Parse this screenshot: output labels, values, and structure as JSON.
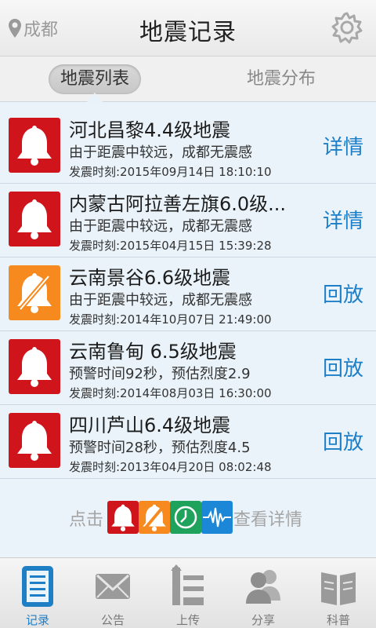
{
  "header": {
    "location": "成都",
    "title": "地震记录"
  },
  "tabs": [
    {
      "label": "地震列表",
      "active": true
    },
    {
      "label": "地震分布",
      "active": false
    }
  ],
  "records": [
    {
      "title": "河北昌黎4.4级地震",
      "subtitle": "由于距震中较远，成都无震感",
      "time": "发震时刻:2015年09月14日 18:10:10",
      "action": "详情",
      "icon": "bell-icon",
      "icon_color": "#d0141c"
    },
    {
      "title": "内蒙古阿拉善左旗6.0级...",
      "subtitle": "由于距震中较远，成都无震感",
      "time": "发震时刻:2015年04月15日 15:39:28",
      "action": "详情",
      "icon": "bell-icon",
      "icon_color": "#d0141c"
    },
    {
      "title": "云南景谷6.6级地震",
      "subtitle": "由于距震中较远，成都无震感",
      "time": "发震时刻:2014年10月07日 21:49:00",
      "action": "回放",
      "icon": "bell-muted-icon",
      "icon_color": "#f68a1f"
    },
    {
      "title": "云南鲁甸 6.5级地震",
      "subtitle": "预警时间92秒，预估烈度2.9",
      "time": "发震时刻:2014年08月03日 16:30:00",
      "action": "回放",
      "icon": "bell-icon",
      "icon_color": "#d0141c"
    },
    {
      "title": "四川芦山6.4级地震",
      "subtitle": "预警时间28秒，预估烈度4.5",
      "time": "发震时刻:2013年04月20日 08:02:48",
      "action": "回放",
      "icon": "bell-icon",
      "icon_color": "#d0141c"
    }
  ],
  "legend": {
    "prefix": "点击",
    "suffix": "查看详情",
    "icons": [
      {
        "name": "bell-icon",
        "color": "#d0141c"
      },
      {
        "name": "bell-muted-icon",
        "color": "#f68a1f"
      },
      {
        "name": "clock-icon",
        "color": "#1fa35c"
      },
      {
        "name": "waveform-icon",
        "color": "#1b87d6"
      }
    ]
  },
  "nav": [
    {
      "label": "记录",
      "icon": "document-list-icon",
      "active": true
    },
    {
      "label": "公告",
      "icon": "envelope-icon",
      "active": false
    },
    {
      "label": "上传",
      "icon": "upload-icon",
      "active": false
    },
    {
      "label": "分享",
      "icon": "users-icon",
      "active": false
    },
    {
      "label": "科普",
      "icon": "book-icon",
      "active": false
    }
  ]
}
